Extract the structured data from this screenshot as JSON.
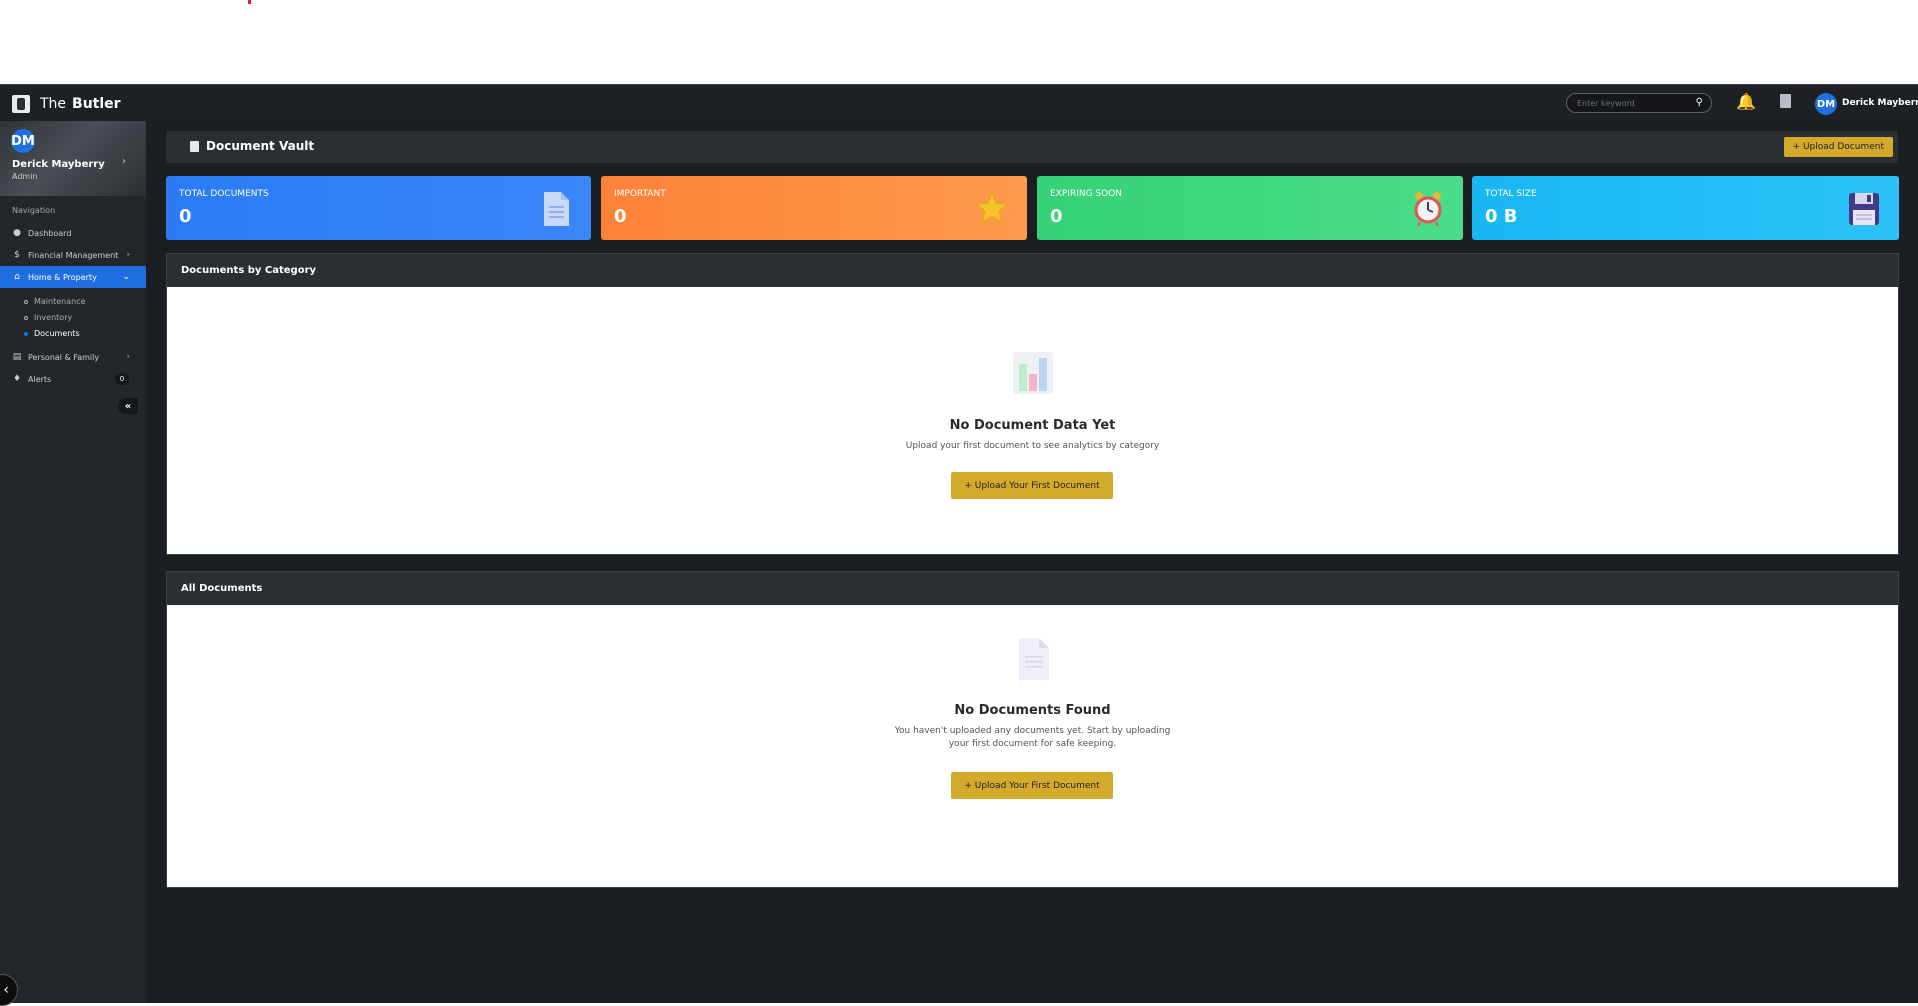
{
  "navbar": {
    "brand_the": "The",
    "brand_name": "Butler",
    "search_placeholder": "Enter keyword",
    "avatar_initials": "DM",
    "user_name": "Derick Mayberry"
  },
  "sidebar": {
    "profile": {
      "initials": "DM",
      "name": "Derick Mayberry",
      "role": "Admin"
    },
    "section_title": "Navigation",
    "items": [
      {
        "label": "Dashboard",
        "icon": "dashboard-icon"
      },
      {
        "label": "Financial Management",
        "icon": "dollar-icon"
      },
      {
        "label": "Home & Property",
        "icon": "home-icon"
      },
      {
        "label": "Personal & Family",
        "icon": "family-icon"
      },
      {
        "label": "Alerts",
        "icon": "bell-icon",
        "badge": "0"
      }
    ],
    "sub_items": [
      {
        "label": "Maintenance"
      },
      {
        "label": "Inventory"
      },
      {
        "label": "Documents"
      }
    ]
  },
  "page": {
    "title": "Document Vault",
    "upload_button": "+ Upload Document"
  },
  "stats": [
    {
      "label": "TOTAL DOCUMENTS",
      "value": "0",
      "color": "#2f7ef6",
      "icon": "document-icon"
    },
    {
      "label": "IMPORTANT",
      "value": "0",
      "color": "#fd8a3c",
      "icon": "star-icon"
    },
    {
      "label": "EXPIRING SOON",
      "value": "0",
      "color": "#3ed67c",
      "icon": "alarm-clock-icon"
    },
    {
      "label": "TOTAL SIZE",
      "value": "0 B",
      "color": "#1fbcf6",
      "icon": "floppy-disk-icon"
    }
  ],
  "category_card": {
    "header": "Documents by Category",
    "empty_title": "No Document Data Yet",
    "empty_text": "Upload your first document to see analytics by category",
    "button": "+ Upload Your First Document"
  },
  "documents_card": {
    "header": "All Documents",
    "empty_title": "No Documents Found",
    "empty_text_line1": "You haven't uploaded any documents yet. Start by uploading",
    "empty_text_line2": "your first document for safe keeping.",
    "button": "+ Upload Your First Document"
  },
  "colors": {
    "accent": "#1f6ee0",
    "button_gold": "#d4aa2c",
    "dark_bg": "#1b1e22"
  }
}
